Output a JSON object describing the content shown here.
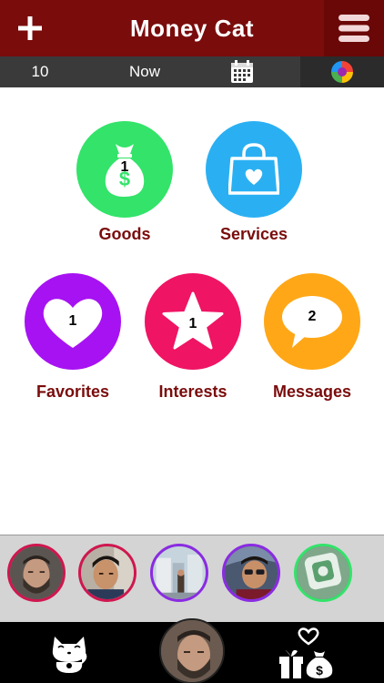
{
  "header": {
    "title": "Money Cat"
  },
  "subbar": {
    "count": "10",
    "time_label": "Now"
  },
  "categories": [
    {
      "label": "Goods",
      "badge": "1",
      "color": "#33e36a"
    },
    {
      "label": "Services",
      "badge": "",
      "color": "#2ab0f2"
    },
    {
      "label": "Favorites",
      "badge": "1",
      "color": "#a712f2"
    },
    {
      "label": "Interests",
      "badge": "1",
      "color": "#ef1464"
    },
    {
      "label": "Messages",
      "badge": "2",
      "color": "#ffa716"
    }
  ],
  "colors": {
    "header_bg": "#7a0c0c",
    "label_text": "#7a0c0c",
    "subbar_bg": "#3a3a3a",
    "strip_bg": "#d4d4d4",
    "bottom_bg": "#000000"
  },
  "friends": [
    {
      "icon": "avatar-man-beard",
      "ring": "#d0164f"
    },
    {
      "icon": "avatar-young-man",
      "ring": "#d0164f"
    },
    {
      "icon": "avatar-street-scene",
      "ring": "#8a2be2"
    },
    {
      "icon": "avatar-man-sunglasses",
      "ring": "#8a2be2"
    },
    {
      "icon": "avatar-app-tile",
      "ring": "#33e36a"
    }
  ],
  "bottom": {
    "left_icon": "lucky-cat-icon",
    "right_icon": "gift-money-heart-icon"
  }
}
